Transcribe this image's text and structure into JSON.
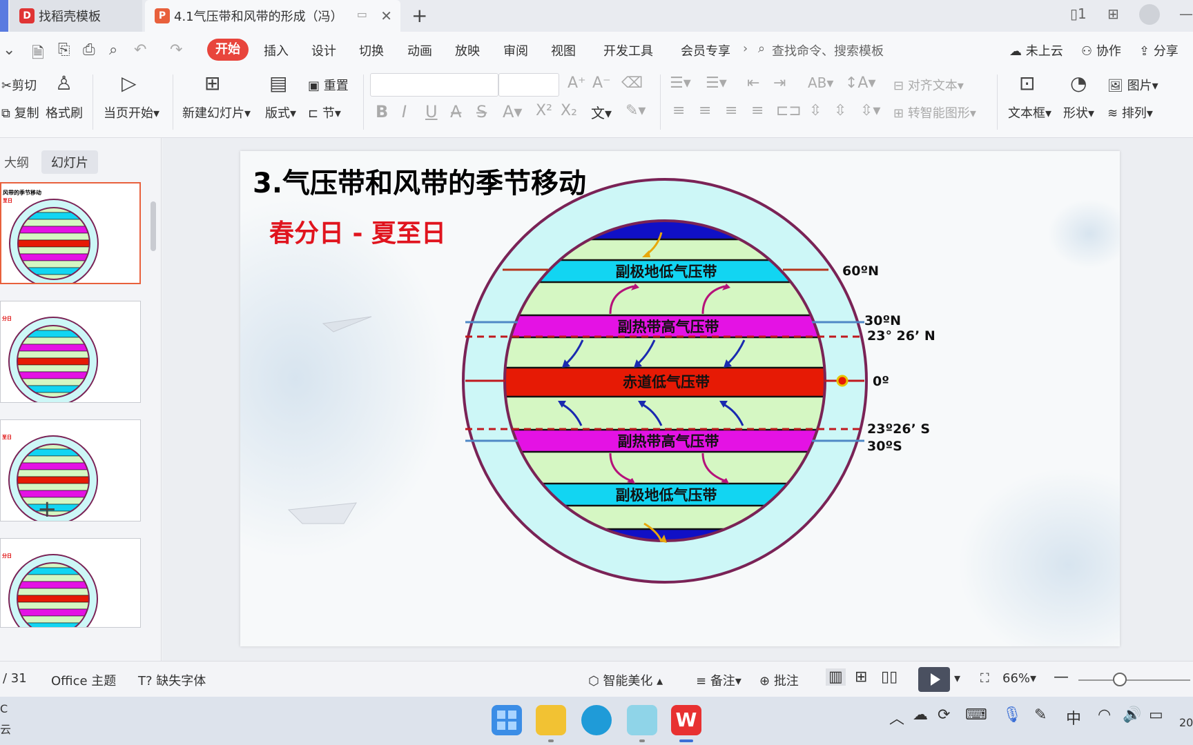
{
  "tabs": [
    {
      "label": "找稻壳模板"
    },
    {
      "label": "4.1气压带和风带的形成（冯）"
    }
  ],
  "menu": [
    "开始",
    "插入",
    "设计",
    "切换",
    "动画",
    "放映",
    "审阅",
    "视图",
    "开发工具",
    "会员专享"
  ],
  "search_placeholder": "查找命令、搜索模板",
  "top_right": {
    "cloud": "未上云",
    "collab": "协作",
    "share": "分享"
  },
  "ribbon": {
    "cut": "剪切",
    "copy": "复制",
    "format_painter": "格式刷",
    "play_from_current": "当页开始",
    "new_slide": "新建幻灯片",
    "layout": "版式",
    "reset": "重置",
    "section": "节",
    "align_text": "对齐文本",
    "smartart": "转智能图形",
    "textbox": "文本框",
    "shape": "形状",
    "picture": "图片",
    "arrange": "排列"
  },
  "left_panel": {
    "tab_outline": "大纲",
    "tab_slides": "幻灯片"
  },
  "thumbs": [
    {
      "cap": "风带的季节移动",
      "cap2": "至日",
      "selected": true
    },
    {
      "cap": "",
      "cap2": "分日",
      "selected": false
    },
    {
      "cap": "",
      "cap2": "至日",
      "selected": false
    },
    {
      "cap": "",
      "cap2": "分日",
      "selected": false
    }
  ],
  "slide": {
    "title": "3.气压带和风带的季节移动",
    "subtitle": "春分日 - 夏至日",
    "bands": {
      "subpolar_n": "副极地低气压带",
      "subtropical_n": "副热带高气压带",
      "equator": "赤道低气压带",
      "subtropical_s": "副热带高气压带",
      "subpolar_s": "副极地低气压带"
    },
    "latitudes": {
      "lat60n": "60ºN",
      "lat30n": "30ºN",
      "tropic_n": "23° 26’ N",
      "equator": "0º",
      "tropic_s": "23º26’ S",
      "lat30s": "30ºS"
    },
    "colors": {
      "outer_ring": "#cdf7f7",
      "rim": "#7a2356",
      "cyan": "#12d5f2",
      "magenta": "#e412e4",
      "red": "#e61a05",
      "green": "#d5f7c3",
      "blue": "#1010c6"
    }
  },
  "status": {
    "page": "/ 31",
    "theme": "Office 主题",
    "missing_font": "缺失字体",
    "beautify": "智能美化",
    "notes": "备注",
    "comments": "批注",
    "zoom": "66%"
  },
  "taskbar": {
    "left1": "C",
    "left2": "云",
    "ime": "中",
    "clock": "20"
  }
}
